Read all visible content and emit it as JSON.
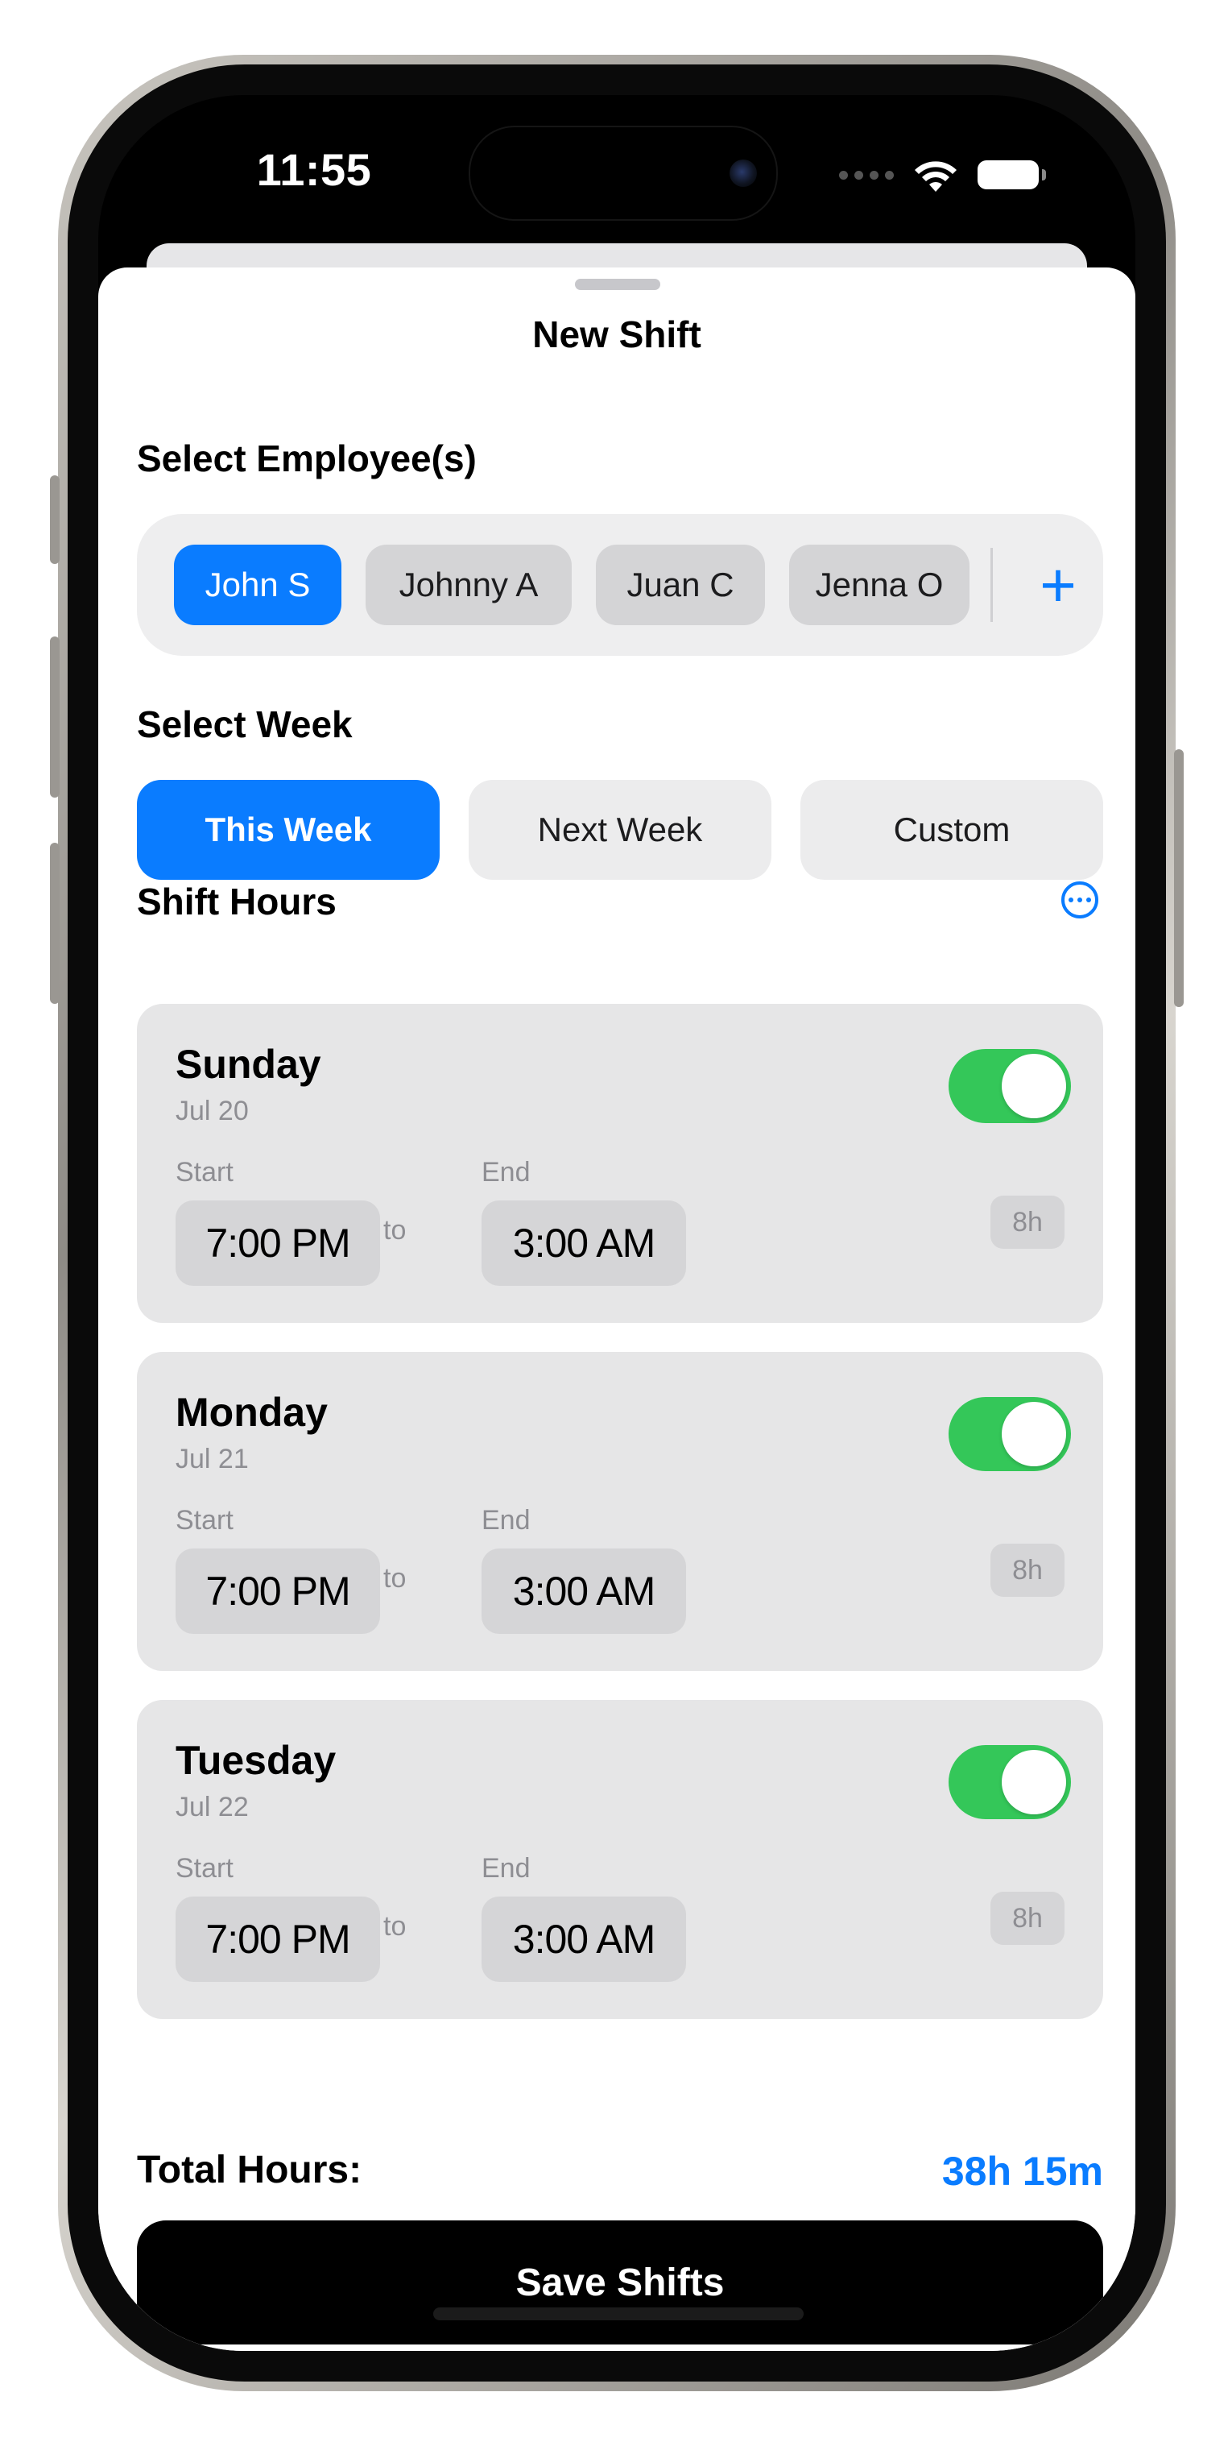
{
  "status_bar": {
    "time": "11:55"
  },
  "sheet": {
    "title": "New Shift"
  },
  "employees": {
    "label": "Select Employee(s)",
    "chips": [
      {
        "name": "John S",
        "selected": true
      },
      {
        "name": "Johnny A",
        "selected": false
      },
      {
        "name": "Juan C",
        "selected": false
      },
      {
        "name": "Jenna O",
        "selected": false
      }
    ],
    "add_icon": "plus-icon"
  },
  "week": {
    "label": "Select Week",
    "options": [
      {
        "label": "This Week",
        "selected": true
      },
      {
        "label": "Next Week",
        "selected": false
      },
      {
        "label": "Custom",
        "selected": false
      }
    ]
  },
  "shift_hours": {
    "label": "Shift Hours",
    "more_icon": "ellipsis-circle-icon",
    "days": [
      {
        "day": "Sunday",
        "date": "Jul 20",
        "enabled": true,
        "start_label": "Start",
        "start": "7:00 PM",
        "to": "to",
        "end_label": "End",
        "end": "3:00 AM",
        "hours": "8h"
      },
      {
        "day": "Monday",
        "date": "Jul 21",
        "enabled": true,
        "start_label": "Start",
        "start": "7:00 PM",
        "to": "to",
        "end_label": "End",
        "end": "3:00 AM",
        "hours": "8h"
      },
      {
        "day": "Tuesday",
        "date": "Jul 22",
        "enabled": true,
        "start_label": "Start",
        "start": "7:00 PM",
        "to": "to",
        "end_label": "End",
        "end": "3:00 AM",
        "hours": "8h"
      }
    ]
  },
  "footer": {
    "total_label": "Total Hours:",
    "total_value": "38h 15m",
    "save_label": "Save Shifts"
  },
  "colors": {
    "accent": "#0a7cff",
    "toggle_on": "#34c759",
    "save_button": "#000000"
  }
}
